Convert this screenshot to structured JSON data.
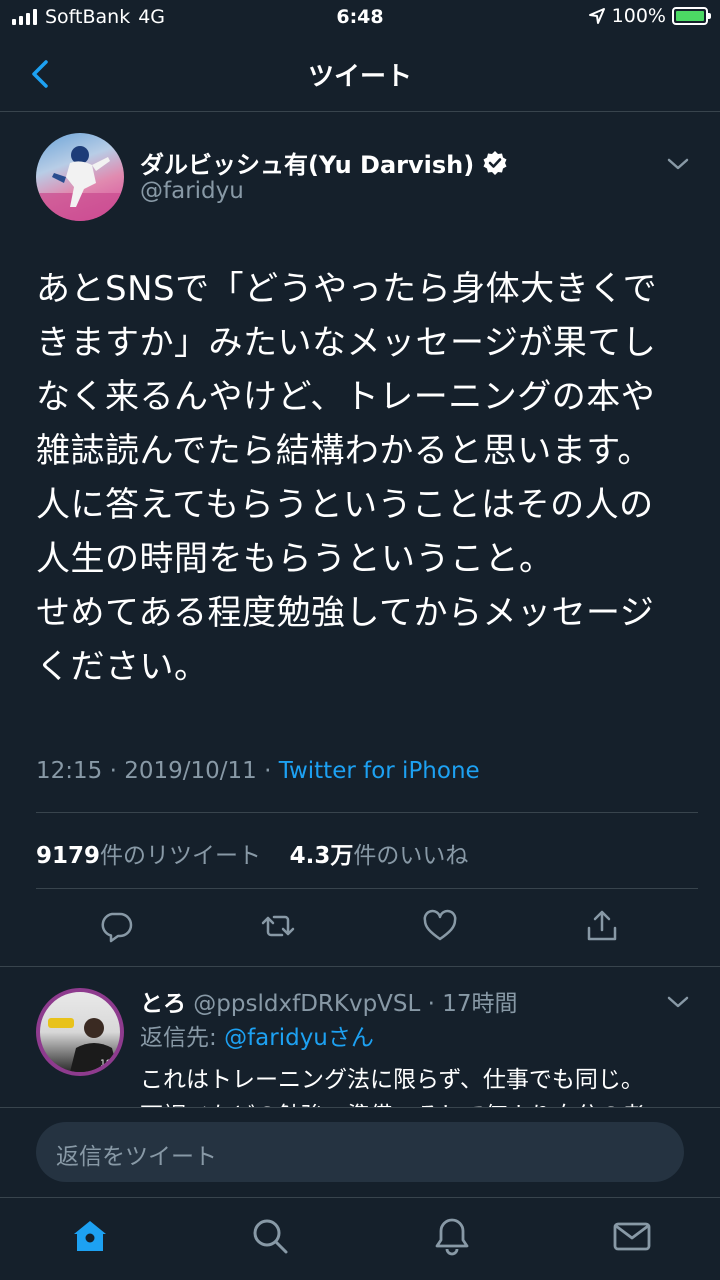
{
  "status_bar": {
    "carrier": "SoftBank",
    "network": "4G",
    "time": "6:48",
    "battery": "100%",
    "icons": [
      "signal-icon",
      "location-icon",
      "battery-icon"
    ]
  },
  "header": {
    "title": "ツイート",
    "back_icon": "chevron-left-icon"
  },
  "tweet": {
    "author_name": "ダルビッシュ有(Yu Darvish)",
    "author_handle": "@faridyu",
    "verified": true,
    "text": "あとSNSで「どうやったら身体大きくで\nきますか」みたいなメッセージが果てし\nなく来るんやけど、トレーニングの本や\n雑誌読んでたら結構わかると思います。\n人に答えてもらうということはその人の\n人生の時間をもらうということ。\nせめてある程度勉強してからメッセージ\nください。",
    "timestamp": "12:15 · 2019/10/11 · ",
    "source": "Twitter for iPhone",
    "retweet_count": "9179",
    "retweet_label": "件のリツイート",
    "like_count": "4.3万",
    "like_label": "件のいいね"
  },
  "actions": [
    "reply-icon",
    "retweet-icon",
    "like-icon",
    "share-icon"
  ],
  "reply": {
    "name": "とろ",
    "handle_time": " @ppsldxfDRKvpVSL · 17時間",
    "reply_to_label": "返信先: ",
    "reply_to_handle": "@faridyuさん",
    "text": "これはトレーニング法に限らず、仕事でも同じ。\n下調べなどの勉強、準備、そして何より自分の考"
  },
  "compose": {
    "placeholder": "返信をツイート"
  },
  "tab_bar": [
    "home-icon",
    "search-icon",
    "notifications-icon",
    "messages-icon"
  ],
  "colors": {
    "background": "#15202b",
    "accent": "#1da1f2",
    "secondary_text": "#8899a6",
    "border": "#38444d"
  }
}
